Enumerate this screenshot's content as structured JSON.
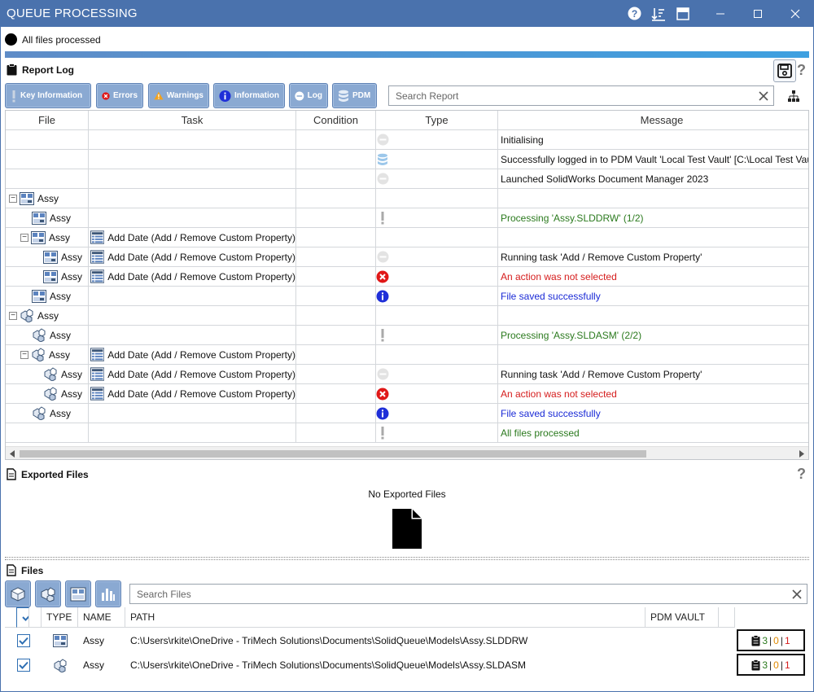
{
  "window": {
    "title": "QUEUE PROCESSING"
  },
  "status": {
    "text": "All files processed"
  },
  "report_log": {
    "title": "Report Log",
    "filters": [
      {
        "label": "Key Information",
        "icon": "exclamation-icon"
      },
      {
        "label": "Errors",
        "icon": "error-icon"
      },
      {
        "label": "Warnings",
        "icon": "warning-icon"
      },
      {
        "label": "Information",
        "icon": "info-icon"
      },
      {
        "label": "Log",
        "icon": "log-icon"
      },
      {
        "label": "PDM",
        "icon": "database-icon"
      }
    ],
    "search_placeholder": "Search Report",
    "columns": [
      "File",
      "Task",
      "Condition",
      "Type",
      "Message"
    ],
    "rows": [
      {
        "file": "",
        "task": "",
        "type": "log",
        "message": "Initialising",
        "msg_color": "dark"
      },
      {
        "file": "",
        "task": "",
        "type": "pdm",
        "message": "Successfully logged in to PDM Vault 'Local Test Vault' [C:\\Local Test Vault]",
        "msg_color": "dark"
      },
      {
        "file": "",
        "task": "",
        "type": "log",
        "message": "Launched SolidWorks Document Manager 2023",
        "msg_color": "dark"
      },
      {
        "file": "Assy",
        "file_icon": "drawing",
        "indent": 0,
        "expander": true,
        "task": "",
        "type": "",
        "message": "",
        "msg_color": "dark"
      },
      {
        "file": "Assy",
        "file_icon": "drawing",
        "indent": 2,
        "task": "",
        "type": "key",
        "message": "Processing 'Assy.SLDDRW' (1/2)",
        "msg_color": "green"
      },
      {
        "file": "Assy",
        "file_icon": "drawing",
        "indent": 1,
        "expander": true,
        "task": "Add Date (Add / Remove Custom Property)",
        "type": "",
        "message": "",
        "msg_color": "dark"
      },
      {
        "file": "Assy",
        "file_icon": "drawing",
        "indent": 3,
        "task": "Add Date (Add / Remove Custom Property)",
        "type": "log",
        "message": "Running task 'Add / Remove Custom Property'",
        "msg_color": "dark"
      },
      {
        "file": "Assy",
        "file_icon": "drawing",
        "indent": 3,
        "task": "Add Date (Add / Remove Custom Property)",
        "type": "error",
        "message": "An action was not selected",
        "msg_color": "red"
      },
      {
        "file": "Assy",
        "file_icon": "drawing",
        "indent": 2,
        "task": "",
        "type": "info",
        "message": "File saved successfully",
        "msg_color": "blue"
      },
      {
        "file": "Assy",
        "file_icon": "assembly",
        "indent": 0,
        "expander": true,
        "task": "",
        "type": "",
        "message": "",
        "msg_color": "dark"
      },
      {
        "file": "Assy",
        "file_icon": "assembly",
        "indent": 2,
        "task": "",
        "type": "key",
        "message": "Processing 'Assy.SLDASM' (2/2)",
        "msg_color": "green"
      },
      {
        "file": "Assy",
        "file_icon": "assembly",
        "indent": 1,
        "expander": true,
        "task": "Add Date (Add / Remove Custom Property)",
        "type": "",
        "message": "",
        "msg_color": "dark"
      },
      {
        "file": "Assy",
        "file_icon": "assembly",
        "indent": 3,
        "task": "Add Date (Add / Remove Custom Property)",
        "type": "log",
        "message": "Running task 'Add / Remove Custom Property'",
        "msg_color": "dark"
      },
      {
        "file": "Assy",
        "file_icon": "assembly",
        "indent": 3,
        "task": "Add Date (Add / Remove Custom Property)",
        "type": "error",
        "message": "An action was not selected",
        "msg_color": "red"
      },
      {
        "file": "Assy",
        "file_icon": "assembly",
        "indent": 2,
        "task": "",
        "type": "info",
        "message": "File saved successfully",
        "msg_color": "blue"
      },
      {
        "file": "",
        "task": "",
        "type": "key",
        "message": "All files processed",
        "msg_color": "green"
      }
    ]
  },
  "exported_files": {
    "title": "Exported Files",
    "empty_text": "No Exported Files"
  },
  "files": {
    "title": "Files",
    "type_buttons": [
      "part-filter-icon",
      "assembly-filter-icon",
      "drawing-filter-icon",
      "chart-filter-icon"
    ],
    "search_placeholder": "Search Files",
    "columns": [
      "TYPE",
      "NAME",
      "PATH",
      "PDM VAULT"
    ],
    "rows": [
      {
        "type_icon": "drawing",
        "name": "Assy",
        "path": "C:\\Users\\rkite\\OneDrive - TriMech Solutions\\Documents\\SolidQueue\\Models\\Assy.SLDDRW",
        "count_ok": "3",
        "count_warn": "0",
        "count_err": "1"
      },
      {
        "type_icon": "assembly",
        "name": "Assy",
        "path": "C:\\Users\\rkite\\OneDrive - TriMech Solutions\\Documents\\SolidQueue\\Models\\Assy.SLDASM",
        "count_ok": "3",
        "count_warn": "0",
        "count_err": "1"
      }
    ]
  },
  "colors": {
    "titlebar": "#4a72ad",
    "button": "#8aa9d2",
    "green": "#2b7a1e",
    "red": "#d51c1c",
    "blue": "#1a2ad6",
    "orange": "#e08a00"
  }
}
